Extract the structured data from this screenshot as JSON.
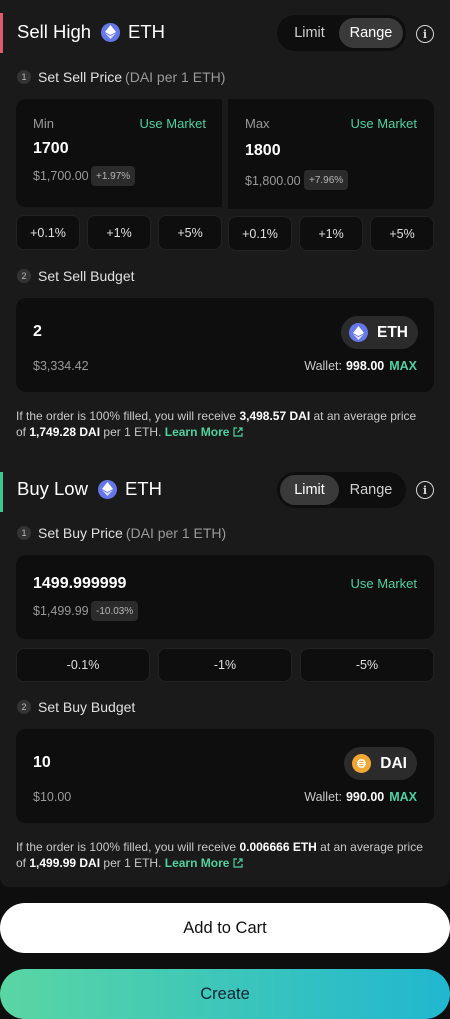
{
  "sell": {
    "title": "Sell High",
    "token": "ETH",
    "toggle": {
      "limit": "Limit",
      "range": "Range",
      "active": "Range"
    },
    "step1": {
      "num": "1",
      "label": "Set Sell Price",
      "sub": "(DAI per 1 ETH)"
    },
    "min": {
      "label": "Min",
      "use_market": "Use Market",
      "value": "1700",
      "usd": "$1,700.00",
      "pct": "+1.97%"
    },
    "max": {
      "label": "Max",
      "use_market": "Use Market",
      "value": "1800",
      "usd": "$1,800.00",
      "pct": "+7.96%"
    },
    "min_adjust": [
      "+0.1%",
      "+1%",
      "+5%"
    ],
    "max_adjust": [
      "+0.1%",
      "+1%",
      "+5%"
    ],
    "step2": {
      "num": "2",
      "label": "Set Sell Budget"
    },
    "budget": {
      "value": "2",
      "usd": "$3,334.42",
      "token": "ETH",
      "wallet_label": "Wallet:",
      "wallet_value": "998.00",
      "max": "MAX"
    },
    "note": {
      "p1": "If the order is 100% filled, you will receive ",
      "amount": "3,498.57 DAI",
      "p2": " at an average price of ",
      "price": "1,749.28 DAI",
      "p3": " per 1 ETH. ",
      "learn": "Learn More"
    }
  },
  "buy": {
    "title": "Buy Low",
    "token": "ETH",
    "toggle": {
      "limit": "Limit",
      "range": "Range",
      "active": "Limit"
    },
    "step1": {
      "num": "1",
      "label": "Set Buy Price",
      "sub": "(DAI per 1 ETH)"
    },
    "price": {
      "value": "1499.999999",
      "use_market": "Use Market",
      "usd": "$1,499.99",
      "pct": "-10.03%"
    },
    "adjust": [
      "-0.1%",
      "-1%",
      "-5%"
    ],
    "step2": {
      "num": "2",
      "label": "Set Buy Budget"
    },
    "budget": {
      "value": "10",
      "usd": "$10.00",
      "token": "DAI",
      "wallet_label": "Wallet:",
      "wallet_value": "990.00",
      "max": "MAX"
    },
    "note": {
      "p1": "If the order is 100% filled, you will receive ",
      "amount": "0.006666 ETH",
      "p2": " at an average price of ",
      "price": "1,499.99 DAI",
      "p3": " per 1 ETH. ",
      "learn": "Learn More"
    }
  },
  "actions": {
    "add_to_cart": "Add to Cart",
    "create": "Create"
  },
  "colors": {
    "accent_green": "#4fd1a1",
    "sell_red": "#e05a6d",
    "buy_green": "#3fc58f",
    "eth_blue": "#6677e8",
    "dai_orange": "#f0a734"
  }
}
